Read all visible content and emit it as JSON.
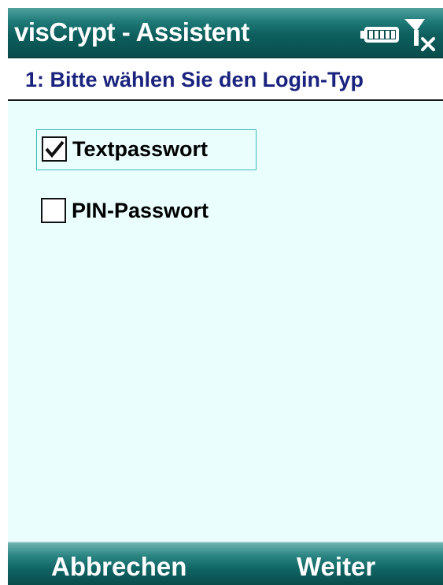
{
  "title_bar": {
    "title": "visCrypt - Assistent",
    "battery_icon": "battery-full-icon",
    "signal_icon": "no-signal-icon"
  },
  "wizard": {
    "step_heading": "1: Bitte wählen Sie den Login-Typ",
    "options": [
      {
        "label": "Textpasswort",
        "checked": true,
        "focused": true
      },
      {
        "label": "PIN-Passwort",
        "checked": false,
        "focused": false
      }
    ]
  },
  "softkeys": {
    "left": "Abbrechen",
    "right": "Weiter"
  },
  "colors": {
    "title_bar": "#0d5f5e",
    "heading_text": "#1a237e",
    "content_bg": "#e9fefd",
    "focus_border": "#3fb7bd"
  }
}
